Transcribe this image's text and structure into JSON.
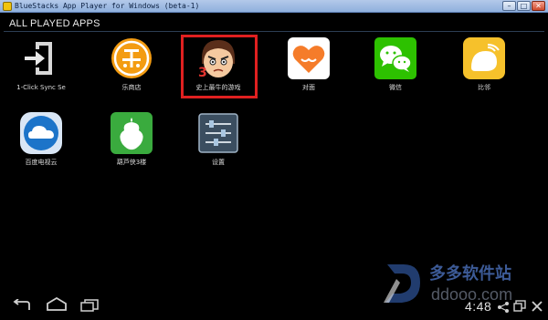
{
  "window": {
    "title": "BlueStacks App Player for Windows (beta-1)",
    "min_symbol": "–",
    "max_symbol": "□",
    "close_symbol": "✕"
  },
  "section": {
    "title": "ALL PLAYED APPS"
  },
  "apps": [
    {
      "label": "1-Click Sync Se",
      "icon": "sync-arrow-icon"
    },
    {
      "label": "乐商店",
      "icon": "le-store-icon"
    },
    {
      "label": "史上最牛的游戏",
      "icon": "angry-face-game-icon",
      "highlighted": true
    },
    {
      "label": "对面",
      "icon": "heart-chat-icon"
    },
    {
      "label": "微信",
      "icon": "wechat-icon"
    },
    {
      "label": "比邻",
      "icon": "bilin-icon"
    },
    {
      "label": "百度电视云",
      "icon": "baidu-cloud-icon"
    },
    {
      "label": "葫芦侠3楼",
      "icon": "gourd-icon"
    },
    {
      "label": "设置",
      "icon": "settings-sliders-icon"
    }
  ],
  "navbar": {
    "clock": "4:48",
    "back_icon": "back-icon",
    "home_icon": "home-icon",
    "recents_icon": "recents-icon",
    "share_icon": "share-icon",
    "screen_icon": "screen-icon",
    "close_icon": "close-icon"
  },
  "watermark": {
    "text1": "多多软件站",
    "text2": "ddooo.com"
  },
  "colors": {
    "highlight": "#e02020",
    "background": "#000000",
    "titlebar": "#a9c1e6"
  }
}
